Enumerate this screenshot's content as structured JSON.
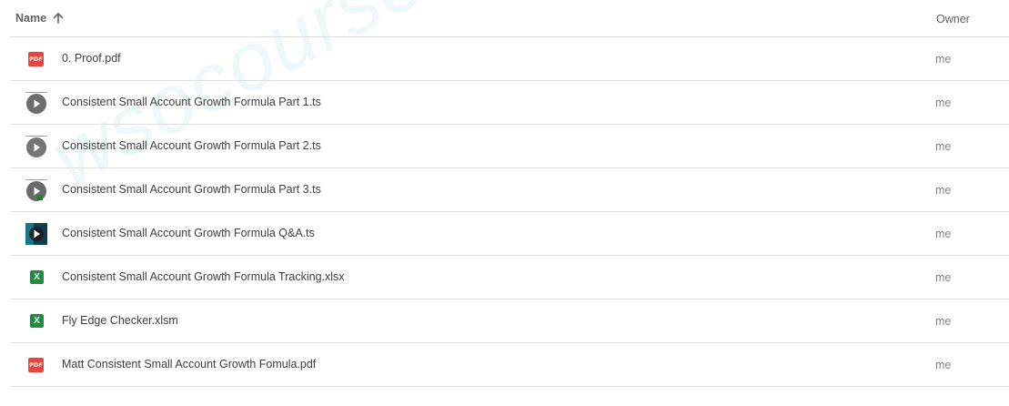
{
  "header": {
    "name_label": "Name",
    "owner_label": "Owner",
    "sort_icon": "arrow-up-icon"
  },
  "files": [
    {
      "name": "0. Proof.pdf",
      "owner": "me",
      "icon": "pdf-icon"
    },
    {
      "name": "Consistent Small Account Growth Formula Part 1.ts",
      "owner": "me",
      "icon": "video-icon"
    },
    {
      "name": "Consistent Small Account Growth Formula Part 2.ts",
      "owner": "me",
      "icon": "video-icon"
    },
    {
      "name": "Consistent Small Account Growth Formula Part 3.ts",
      "owner": "me",
      "icon": "video-icon"
    },
    {
      "name": "Consistent Small Account Growth Formula Q&A.ts",
      "owner": "me",
      "icon": "video-thumbnail-icon"
    },
    {
      "name": "Consistent Small Account Growth Formula Tracking.xlsx",
      "owner": "me",
      "icon": "excel-icon"
    },
    {
      "name": "Fly Edge Checker.xlsm",
      "owner": "me",
      "icon": "excel-icon"
    },
    {
      "name": "Matt Consistent Small Account Growth Fomula.pdf",
      "owner": "me",
      "icon": "pdf-icon"
    }
  ],
  "icons": {
    "pdf_text": "PDF",
    "excel_text": "X"
  },
  "watermark": "wsocourse",
  "colors": {
    "pdf": "#e8453c",
    "excel": "#1e8e3e",
    "video": "#757575",
    "divider": "#e0e0e0"
  }
}
